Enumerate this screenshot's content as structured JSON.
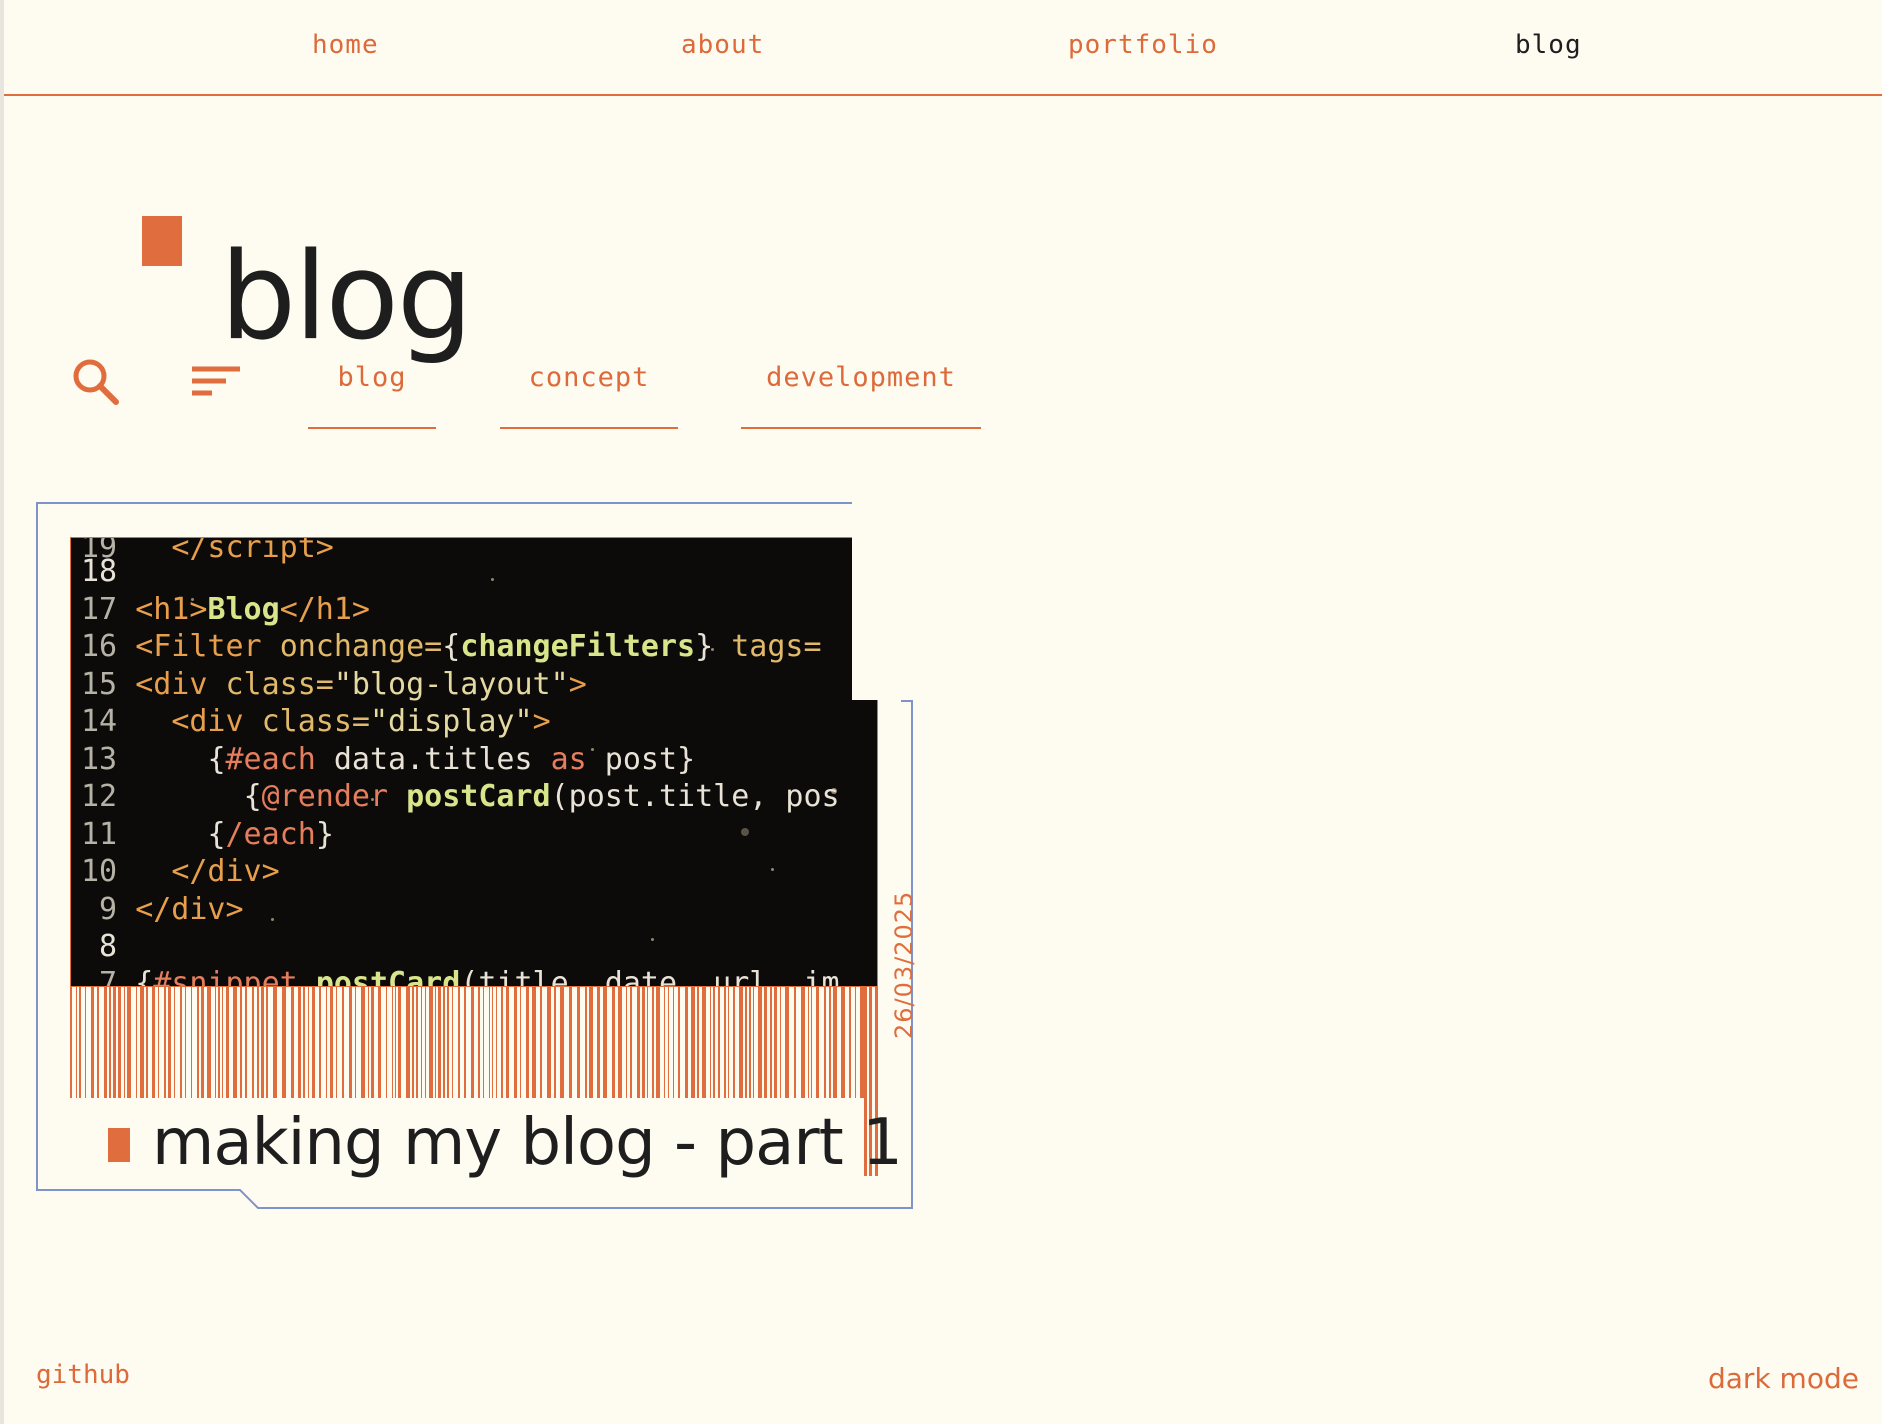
{
  "nav": {
    "items": [
      {
        "label": "home",
        "active": false
      },
      {
        "label": "about",
        "active": false
      },
      {
        "label": "portfolio",
        "active": false
      },
      {
        "label": "blog",
        "active": true
      }
    ]
  },
  "page": {
    "title": "blog"
  },
  "filters": {
    "search_icon": "search-icon",
    "sort_icon": "sort-icon",
    "tags": [
      "blog",
      "concept",
      "development"
    ]
  },
  "posts": [
    {
      "title": "making my blog - part 1",
      "date": "26/03/2025",
      "code_lines": [
        "18",
        "17 <h1>Blog</h1>",
        "16 <Filter onchange={changeFilters} tags=",
        "15 <div class=\"blog-layout\">",
        "14   <div class=\"display\">",
        "13     {#each data.titles as post}",
        "12       {@render postCard(post.title, pos",
        "11     {/each}",
        "10   </div>",
        " 9 </div>",
        " 8"
      ]
    }
  ],
  "footer": {
    "github": "github",
    "dark_mode": "dark mode"
  },
  "colors": {
    "accent": "#e06d3d",
    "background": "#fefbf1",
    "text": "#1e1e1e",
    "card_outline": "#7f93c9"
  }
}
